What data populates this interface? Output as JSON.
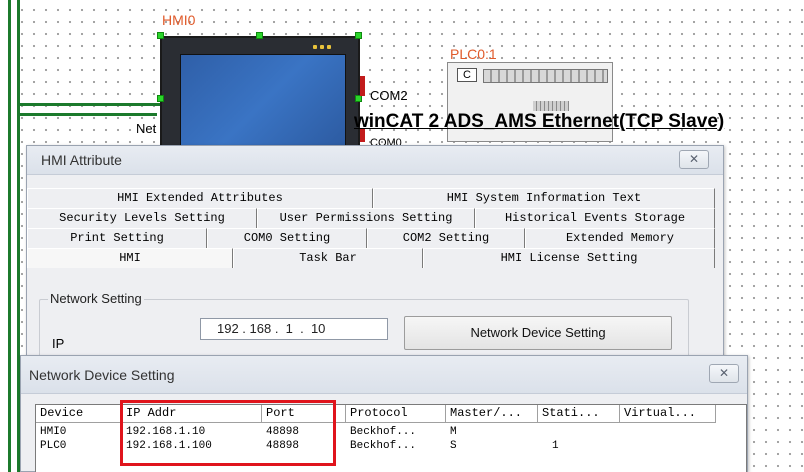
{
  "canvas": {
    "hmi_device_label": "HMI0",
    "plc_device_label": "PLC0:1",
    "com2_label": "COM2",
    "com0_label_partial": "COM0",
    "net_label": "Net",
    "plc_indicator": "C",
    "protocol_banner": "winCAT 2 ADS_AMS Ethernet(TCP Slave)"
  },
  "hmi_attribute": {
    "title": "HMI Attribute",
    "close_symbol": "✕",
    "tab_rows": [
      [
        "HMI Extended Attributes",
        "HMI System Information Text"
      ],
      [
        "Security Levels Setting",
        "User Permissions Setting",
        "Historical Events Storage"
      ],
      [
        "Print Setting",
        "COM0 Setting",
        "COM2 Setting",
        "Extended Memory"
      ],
      [
        "HMI",
        "Task Bar",
        "HMI License Setting"
      ]
    ],
    "network_setting": {
      "group_title": "Network Setting",
      "ip_label": "IP",
      "ip_value": "192 . 168 .  1  .  10",
      "device_button": "Network Device Setting"
    }
  },
  "network_device_setting": {
    "title": "Network Device Setting",
    "close_symbol": "✕",
    "columns": [
      "Device",
      "IP Addr",
      "Port",
      "Protocol",
      "Master/...",
      "Stati...",
      "Virtual..."
    ],
    "rows": [
      [
        "HMI0",
        "192.168.1.10",
        "48898",
        "Beckhof...",
        "M",
        "",
        ""
      ],
      [
        "PLC0",
        "192.168.1.100",
        "48898",
        "Beckhof...",
        "S",
        "1",
        ""
      ]
    ],
    "highlight_color": "#e0141c"
  },
  "colors": {
    "bus_green": "#1c7a2c",
    "label_orange": "#e05a2a",
    "handle_green": "#2bd52b"
  }
}
